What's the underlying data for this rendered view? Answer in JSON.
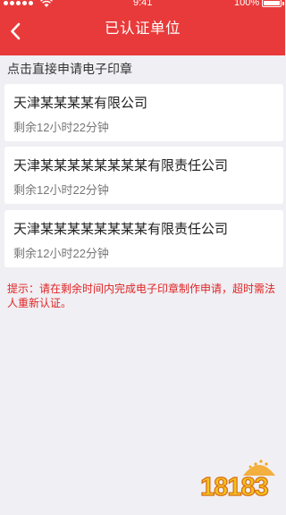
{
  "status_bar": {
    "time": "9:41",
    "battery": "100%"
  },
  "header": {
    "title": "已认证单位",
    "back_icon": "chevron-left-icon"
  },
  "section_label": "点击直接申请电子印章",
  "companies": [
    {
      "name": "天津某某某某有限公司",
      "remaining": "剩余12小时22分钟"
    },
    {
      "name": "天津某某某某某某某某有限责任公司",
      "remaining": "剩余12小时22分钟"
    },
    {
      "name": "天津某某某某某某某某有限责任公司",
      "remaining": "剩余12小时22分钟"
    }
  ],
  "hint": "提示：请在剩余时间内完成电子印章制作申请，超时需法人重新认证。",
  "watermark_text": "18183",
  "colors": {
    "accent": "#e83a3a",
    "background": "#f0eff4",
    "hint": "#e02424"
  }
}
